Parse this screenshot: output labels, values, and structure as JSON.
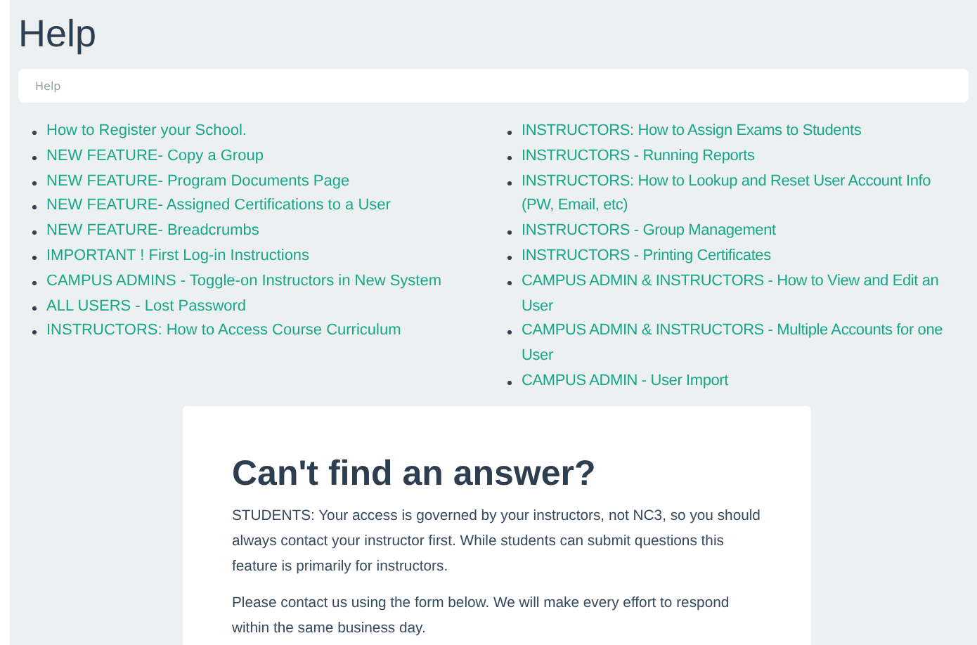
{
  "page": {
    "title": "Help"
  },
  "breadcrumb": [
    "Help"
  ],
  "links_left": [
    {
      "label": "How to Register your School."
    },
    {
      "label": "NEW FEATURE- Copy a Group"
    },
    {
      "label": "NEW FEATURE- Program Documents Page"
    },
    {
      "label": "NEW FEATURE- Assigned Certifications to a User"
    },
    {
      "label": "NEW FEATURE- Breadcrumbs"
    },
    {
      "label": "IMPORTANT ! First Log-in Instructions"
    },
    {
      "label": "CAMPUS ADMINS - Toggle-on Instructors in New System"
    },
    {
      "label": "ALL USERS - Lost Password"
    },
    {
      "label": "INSTRUCTORS: How to Access Course Curriculum"
    }
  ],
  "links_right": [
    {
      "label": "INSTRUCTORS: How to Assign Exams to Students"
    },
    {
      "label": "INSTRUCTORS - Running Reports"
    },
    {
      "label": "INSTRUCTORS: How to Lookup and Reset User Account Info (PW, Email, etc)"
    },
    {
      "label": "INSTRUCTORS - Group Management"
    },
    {
      "label": "INSTRUCTORS - Printing Certificates"
    },
    {
      "label": "CAMPUS ADMIN & INSTRUCTORS - How to View and Edit an User"
    },
    {
      "label": "CAMPUS ADMIN & INSTRUCTORS - Multiple Accounts for one User"
    },
    {
      "label": "CAMPUS ADMIN - User Import"
    }
  ],
  "contact": {
    "heading": "Can't find an answer?",
    "paragraphs": [
      "STUDENTS: Your access is governed by your instructors, not NC3, so you should always contact your instructor first. While students can submit questions this feature is primarily for instructors.",
      "Please contact us using the form below. We will make every effort to respond within the same business day."
    ]
  }
}
